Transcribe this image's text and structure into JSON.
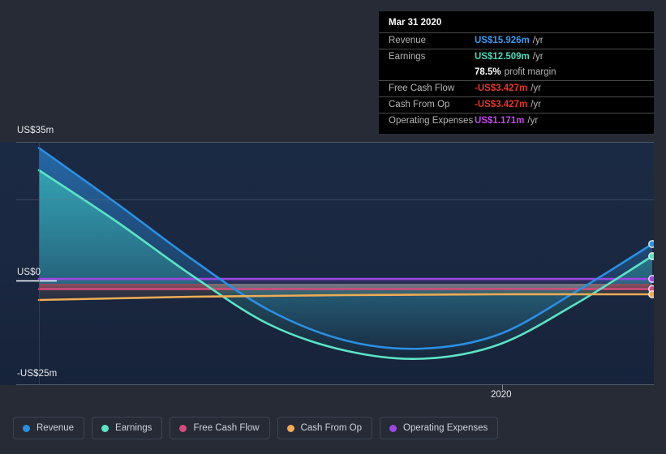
{
  "chart_data": {
    "type": "line",
    "title": "",
    "xlabel": "",
    "ylabel": "",
    "ylim": [
      -25,
      35
    ],
    "y_ticks": [
      "US$35m",
      "US$0",
      "-US$25m"
    ],
    "y_tick_values": [
      35,
      0,
      -25
    ],
    "x_ticks": [
      "2020"
    ],
    "grid": true,
    "legend_position": "bottom-left",
    "units": "US$ millions per year",
    "x": [
      "2014",
      "2015",
      "2016",
      "2017",
      "2018",
      "2019",
      "2020",
      "2021",
      "2022"
    ],
    "series": [
      {
        "name": "Revenue",
        "color": "#2b8fe3",
        "values": [
          33.5,
          20.0,
          6.0,
          -6.5,
          -14.0,
          -16.0,
          -12.5,
          -2.0,
          9.8
        ]
      },
      {
        "name": "Earnings",
        "color": "#5de3c7",
        "values": [
          28.0,
          15.5,
          2.0,
          -10.0,
          -16.5,
          -18.5,
          -15.0,
          -5.0,
          6.8
        ]
      },
      {
        "name": "Free Cash Flow",
        "color": "#d34c7f",
        "values": [
          -1.3,
          -1.3,
          -1.3,
          -1.3,
          -1.3,
          -1.3,
          -1.3,
          -1.3,
          -1.3
        ]
      },
      {
        "name": "Cash From Op",
        "color": "#eeab56",
        "values": [
          -4.0,
          -3.6,
          -3.2,
          -3.0,
          -2.8,
          -2.7,
          -2.6,
          -2.6,
          -2.6
        ]
      },
      {
        "name": "Operating Expenses",
        "color": "#9b48e0",
        "values": [
          1.2,
          1.2,
          1.2,
          1.2,
          1.2,
          1.2,
          1.2,
          1.2,
          1.2
        ]
      }
    ]
  },
  "axis": {
    "y_top": "US$35m",
    "y_zero": "US$0",
    "y_bottom": "-US$25m",
    "x_tick_2020": "2020"
  },
  "tooltip": {
    "date": "Mar 31 2020",
    "rows": [
      {
        "label": "Revenue",
        "value": "US$15.926m",
        "unit": "/yr",
        "color": "#3b9bf0"
      },
      {
        "label": "Earnings",
        "value": "US$12.509m",
        "unit": "/yr",
        "color": "#4cd9bc"
      },
      {
        "label": "",
        "value": "78.5%",
        "unit": "profit margin",
        "color": "#ffffff"
      },
      {
        "label": "Free Cash Flow",
        "value": "-US$3.427m",
        "unit": "/yr",
        "color": "#e8372c"
      },
      {
        "label": "Cash From Op",
        "value": "-US$3.427m",
        "unit": "/yr",
        "color": "#e8372c"
      },
      {
        "label": "Operating Expenses",
        "value": "US$1.171m",
        "unit": "/yr",
        "color": "#c44ae8"
      }
    ]
  },
  "legend": {
    "items": [
      {
        "label": "Revenue",
        "color": "#2b8fe3"
      },
      {
        "label": "Earnings",
        "color": "#5de3c7"
      },
      {
        "label": "Free Cash Flow",
        "color": "#d34c7f"
      },
      {
        "label": "Cash From Op",
        "color": "#eeab56"
      },
      {
        "label": "Operating Expenses",
        "color": "#9b48e0"
      }
    ]
  }
}
